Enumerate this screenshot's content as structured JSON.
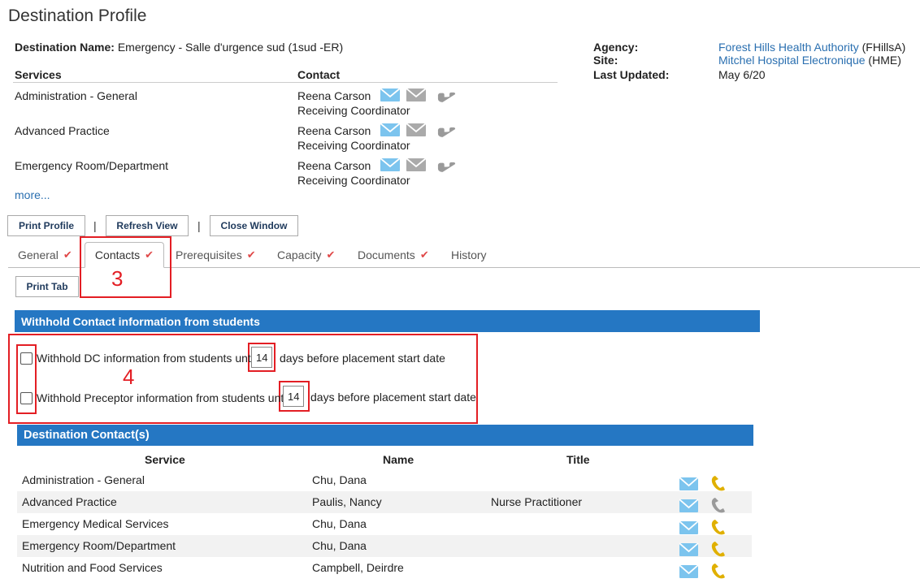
{
  "page": {
    "title": "Destination Profile"
  },
  "destination": {
    "name_label": "Destination Name",
    "name_value": "Emergency - Salle d'urgence sud (1sud -ER)"
  },
  "info": {
    "agency_label": "Agency",
    "agency_link": "Forest Hills Health Authority",
    "agency_abbr": "(FHillsA)",
    "site_label": "Site",
    "site_link": "Mitchel Hospital Electronique",
    "site_abbr": "(HME)",
    "updated_label": "Last Updated",
    "updated_value": "May 6/20",
    "colon": ":"
  },
  "services_summary": {
    "services_header": "Services",
    "contact_header": "Contact",
    "rows": [
      {
        "service": "Administration - General",
        "contact": "Reena Carson",
        "role": "Receiving Coordinator"
      },
      {
        "service": "Advanced Practice",
        "contact": "Reena Carson",
        "role": "Receiving Coordinator"
      },
      {
        "service": "Emergency Room/Department",
        "contact": "Reena Carson",
        "role": "Receiving Coordinator"
      }
    ],
    "more_link": "more..."
  },
  "toolbar": {
    "print_profile": "Print Profile",
    "refresh_view": "Refresh View",
    "close_window": "Close Window",
    "separator": "|"
  },
  "tabs": [
    {
      "label": "General",
      "check": "✔"
    },
    {
      "label": "Contacts",
      "check": "✔"
    },
    {
      "label": "Prerequisites",
      "check": "✔"
    },
    {
      "label": "Capacity",
      "check": "✔"
    },
    {
      "label": "Documents",
      "check": "✔"
    },
    {
      "label": "History",
      "check": ""
    }
  ],
  "print_tab": "Print Tab",
  "annotations": {
    "three": "3",
    "four": "4"
  },
  "withhold": {
    "header": "Withhold Contact information from students",
    "dc_text_before": "Withhold DC information from students until",
    "dc_days": "14",
    "dc_text_after": "days before placement start date",
    "preceptor_text_before": "Withhold Preceptor information from students until",
    "preceptor_days": "14",
    "preceptor_text_after": "days before placement start date"
  },
  "contacts": {
    "header": "Destination Contact(s)",
    "columns": {
      "service": "Service",
      "name": "Name",
      "title": "Title"
    },
    "rows": [
      {
        "service": "Administration - General",
        "name": "Chu, Dana",
        "title": ""
      },
      {
        "service": "Advanced Practice",
        "name": "Paulis, Nancy",
        "title": "Nurse Practitioner"
      },
      {
        "service": "Emergency Medical Services",
        "name": "Chu, Dana",
        "title": ""
      },
      {
        "service": "Emergency Room/Department",
        "name": "Chu, Dana",
        "title": ""
      },
      {
        "service": "Nutrition and Food Services",
        "name": "Campbell, Deirdre",
        "title": ""
      }
    ]
  },
  "colors": {
    "accent_blue": "#2577c3",
    "link": "#2a6fb0",
    "check_red": "#e04848",
    "highlight_red": "#e31e24",
    "phone_gold": "#e0b000",
    "email_blue": "#7cc4ee"
  }
}
